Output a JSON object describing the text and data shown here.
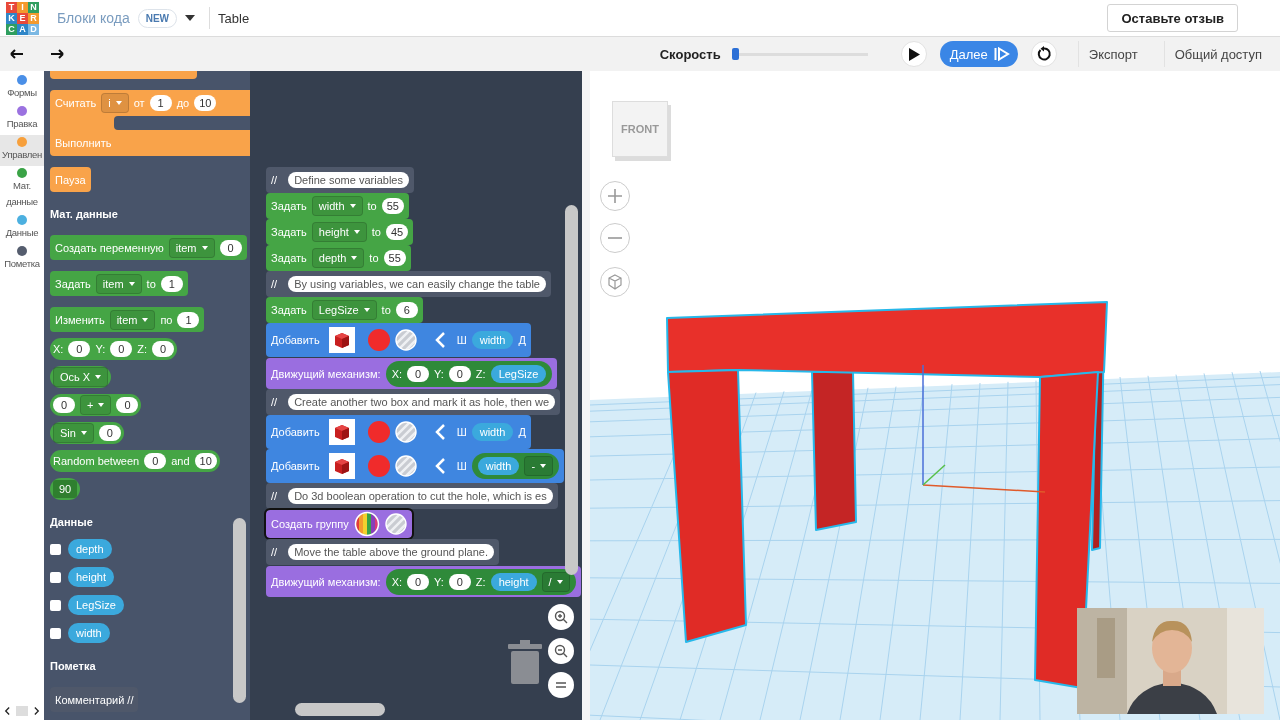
{
  "header": {
    "logo": [
      "T",
      "I",
      "N",
      "K",
      "E",
      "R",
      "C",
      "A",
      "D"
    ],
    "section": "Блоки кода",
    "badge": "NEW",
    "title": "Table",
    "feedback": "Оставьте отзыв"
  },
  "toolbar": {
    "speed_label": "Скорость",
    "speed": {
      "level": 0.02
    },
    "next": "Далее",
    "export": "Экспорт",
    "share": "Общий доступ"
  },
  "categories": [
    {
      "label": "Формы",
      "color": "#4a8fe7",
      "selected": false
    },
    {
      "label": "Правка",
      "color": "#9b72e0",
      "selected": false
    },
    {
      "label": "Управлен",
      "color": "#f7a03c",
      "selected": true
    },
    {
      "label": "Мат. данные",
      "color": "#3aa346",
      "selected": false
    },
    {
      "label": "Данные",
      "color": "#4cb0e0",
      "selected": false
    },
    {
      "label": "Пометка",
      "color": "#555d6e",
      "selected": false
    }
  ],
  "palette": [
    {
      "kind": "loop",
      "parts": [
        {
          "kind": "text",
          "text": "Считать"
        },
        {
          "kind": "dropdown",
          "text": "i"
        },
        {
          "kind": "text",
          "text": "от"
        },
        {
          "kind": "input",
          "text": "1"
        },
        {
          "kind": "text",
          "text": "до"
        },
        {
          "kind": "input",
          "text": "10"
        }
      ],
      "inner": [
        {
          "kind": "text",
          "text": "Выполнить"
        }
      ]
    },
    {
      "kind": "control",
      "parts": [
        {
          "kind": "text",
          "text": "Пауза"
        }
      ]
    },
    {
      "kind": "heading",
      "text": "Мат. данные"
    },
    {
      "kind": "math",
      "parts": [
        {
          "kind": "text",
          "text": "Создать переменную"
        },
        {
          "kind": "dropdown",
          "text": "item"
        },
        {
          "kind": "input",
          "text": "0"
        }
      ]
    },
    {
      "kind": "math",
      "parts": [
        {
          "kind": "text",
          "text": "Задать"
        },
        {
          "kind": "dropdown",
          "text": "item"
        },
        {
          "kind": "text",
          "text": "to"
        },
        {
          "kind": "input",
          "text": "1"
        }
      ]
    },
    {
      "kind": "math",
      "parts": [
        {
          "kind": "text",
          "text": "Изменить"
        },
        {
          "kind": "dropdown",
          "text": "item"
        },
        {
          "kind": "text",
          "text": "по"
        },
        {
          "kind": "input",
          "text": "1"
        }
      ]
    },
    {
      "kind": "value",
      "parts": [
        {
          "kind": "text",
          "text": "X:"
        },
        {
          "kind": "input",
          "text": "0"
        },
        {
          "kind": "text",
          "text": "Y:"
        },
        {
          "kind": "input",
          "text": "0"
        },
        {
          "kind": "text",
          "text": "Z:"
        },
        {
          "kind": "input",
          "text": "0"
        }
      ]
    },
    {
      "kind": "value",
      "parts": [
        {
          "kind": "dropdown",
          "text": "Ось X"
        }
      ]
    },
    {
      "kind": "value",
      "parts": [
        {
          "kind": "input",
          "text": "0"
        },
        {
          "kind": "dropdown",
          "text": "+"
        },
        {
          "kind": "input",
          "text": "0"
        }
      ]
    },
    {
      "kind": "value",
      "parts": [
        {
          "kind": "dropdown",
          "text": "Sin"
        },
        {
          "kind": "input",
          "text": "0"
        }
      ]
    },
    {
      "kind": "value",
      "parts": [
        {
          "kind": "text",
          "text": "Random between"
        },
        {
          "kind": "input",
          "text": "0"
        },
        {
          "kind": "text",
          "text": "and"
        },
        {
          "kind": "input",
          "text": "10"
        }
      ]
    },
    {
      "kind": "value",
      "parts": [
        {
          "kind": "field",
          "text": "90"
        }
      ]
    },
    {
      "kind": "heading",
      "text": "Данные"
    },
    {
      "kind": "variable",
      "text": "depth",
      "checked": false
    },
    {
      "kind": "variable",
      "text": "height",
      "checked": false
    },
    {
      "kind": "variable",
      "text": "LegSize",
      "checked": false
    },
    {
      "kind": "variable",
      "text": "width",
      "checked": false
    },
    {
      "kind": "heading",
      "text": "Пометка"
    },
    {
      "kind": "note",
      "parts": [
        {
          "kind": "text",
          "text": "Комментарий //"
        }
      ]
    }
  ],
  "workspace": [
    {
      "kind": "note",
      "selected": false,
      "parts": [
        {
          "kind": "text",
          "text": "//"
        },
        {
          "kind": "comment",
          "text": "Define some variables"
        }
      ]
    },
    {
      "kind": "math",
      "selected": false,
      "parts": [
        {
          "kind": "text",
          "text": "Задать"
        },
        {
          "kind": "dropdown",
          "text": "width"
        },
        {
          "kind": "text",
          "text": "to"
        },
        {
          "kind": "input",
          "text": "55"
        }
      ]
    },
    {
      "kind": "math",
      "selected": false,
      "parts": [
        {
          "kind": "text",
          "text": "Задать"
        },
        {
          "kind": "dropdown",
          "text": "height"
        },
        {
          "kind": "text",
          "text": "to"
        },
        {
          "kind": "input",
          "text": "45"
        }
      ]
    },
    {
      "kind": "math",
      "selected": false,
      "parts": [
        {
          "kind": "text",
          "text": "Задать"
        },
        {
          "kind": "dropdown",
          "text": "depth"
        },
        {
          "kind": "text",
          "text": "to"
        },
        {
          "kind": "input",
          "text": "55"
        }
      ]
    },
    {
      "kind": "note",
      "selected": false,
      "parts": [
        {
          "kind": "text",
          "text": "//"
        },
        {
          "kind": "comment",
          "text": "By using variables, we can easily change the table"
        }
      ]
    },
    {
      "kind": "math",
      "selected": false,
      "parts": [
        {
          "kind": "text",
          "text": "Задать"
        },
        {
          "kind": "dropdown",
          "text": "LegSize"
        },
        {
          "kind": "text",
          "text": "to"
        },
        {
          "kind": "input",
          "text": "6"
        }
      ]
    },
    {
      "kind": "shape",
      "selected": false,
      "parts": [
        {
          "kind": "text",
          "text": "Добавить"
        },
        {
          "kind": "cube"
        },
        {
          "kind": "color",
          "color": "#f02b2b"
        },
        {
          "kind": "stripes"
        },
        {
          "kind": "chevron"
        },
        {
          "kind": "text",
          "text": "Ш"
        },
        {
          "kind": "var",
          "text": "width"
        },
        {
          "kind": "text",
          "text": "Д"
        }
      ]
    },
    {
      "kind": "modify",
      "selected": false,
      "parts": [
        {
          "kind": "text",
          "text": "Движущий механизм:"
        },
        {
          "kind": "group",
          "parts": [
            {
              "kind": "text",
              "text": "X:"
            },
            {
              "kind": "input",
              "text": "0"
            },
            {
              "kind": "text",
              "text": "Y:"
            },
            {
              "kind": "input",
              "text": "0"
            },
            {
              "kind": "text",
              "text": "Z:"
            },
            {
              "kind": "var",
              "text": "LegSize"
            }
          ]
        }
      ]
    },
    {
      "kind": "note",
      "selected": false,
      "parts": [
        {
          "kind": "text",
          "text": "//"
        },
        {
          "kind": "comment",
          "text": "Create another two box and mark it as hole, then we"
        }
      ]
    },
    {
      "kind": "shape",
      "selected": false,
      "parts": [
        {
          "kind": "text",
          "text": "Добавить"
        },
        {
          "kind": "cube"
        },
        {
          "kind": "color",
          "color": "#f02b2b"
        },
        {
          "kind": "stripes"
        },
        {
          "kind": "chevron"
        },
        {
          "kind": "text",
          "text": "Ш"
        },
        {
          "kind": "var",
          "text": "width"
        },
        {
          "kind": "text",
          "text": "Д"
        }
      ]
    },
    {
      "kind": "shape",
      "selected": false,
      "parts": [
        {
          "kind": "text",
          "text": "Добавить"
        },
        {
          "kind": "cube"
        },
        {
          "kind": "color",
          "color": "#f02b2b"
        },
        {
          "kind": "stripes"
        },
        {
          "kind": "chevron"
        },
        {
          "kind": "text",
          "text": "Ш"
        },
        {
          "kind": "group",
          "parts": [
            {
              "kind": "var",
              "text": "width"
            },
            {
              "kind": "dropdown",
              "text": "-"
            }
          ]
        }
      ]
    },
    {
      "kind": "note",
      "selected": false,
      "parts": [
        {
          "kind": "text",
          "text": "//"
        },
        {
          "kind": "comment",
          "text": "Do 3d boolean operation to cut the hole, which is es"
        }
      ]
    },
    {
      "kind": "group",
      "selected": true,
      "parts": [
        {
          "kind": "text",
          "text": "Создать группу"
        },
        {
          "kind": "rainbow"
        },
        {
          "kind": "stripes"
        }
      ]
    },
    {
      "kind": "note",
      "selected": false,
      "parts": [
        {
          "kind": "text",
          "text": "//"
        },
        {
          "kind": "comment",
          "text": "Move the table above the ground plane."
        }
      ]
    },
    {
      "kind": "modify",
      "selected": false,
      "parts": [
        {
          "kind": "text",
          "text": "Движущий механизм:"
        },
        {
          "kind": "group",
          "parts": [
            {
              "kind": "text",
              "text": "X:"
            },
            {
              "kind": "input",
              "text": "0"
            },
            {
              "kind": "text",
              "text": "Y:"
            },
            {
              "kind": "input",
              "text": "0"
            },
            {
              "kind": "text",
              "text": "Z:"
            },
            {
              "kind": "var",
              "text": "height"
            },
            {
              "kind": "dropdown",
              "text": "/"
            }
          ]
        }
      ]
    }
  ],
  "viewport": {
    "view_cube": "FRONT"
  }
}
